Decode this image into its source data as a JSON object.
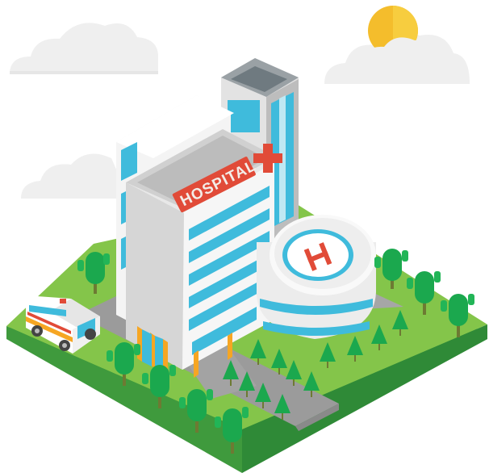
{
  "scene": {
    "building_sign": "HOSPITAL",
    "sign_icon": "red-cross-icon",
    "helipad_letter": "H",
    "ambulance_icon": "ambulance-icon",
    "sun_icon": "sun-icon",
    "tree_icon": "tree-icon",
    "colors": {
      "grass": "#84c54a",
      "grass_edge": "#3f9a3d",
      "road": "#9b9b9b",
      "tree": "#1ba84e",
      "window": "#3fbbdc",
      "wall": "#e8e8e8",
      "roof": "#ffffff",
      "accent": "#e14b38",
      "door": "#f6a623",
      "sun": "#f4bd2c",
      "cloud": "#efefef"
    }
  }
}
